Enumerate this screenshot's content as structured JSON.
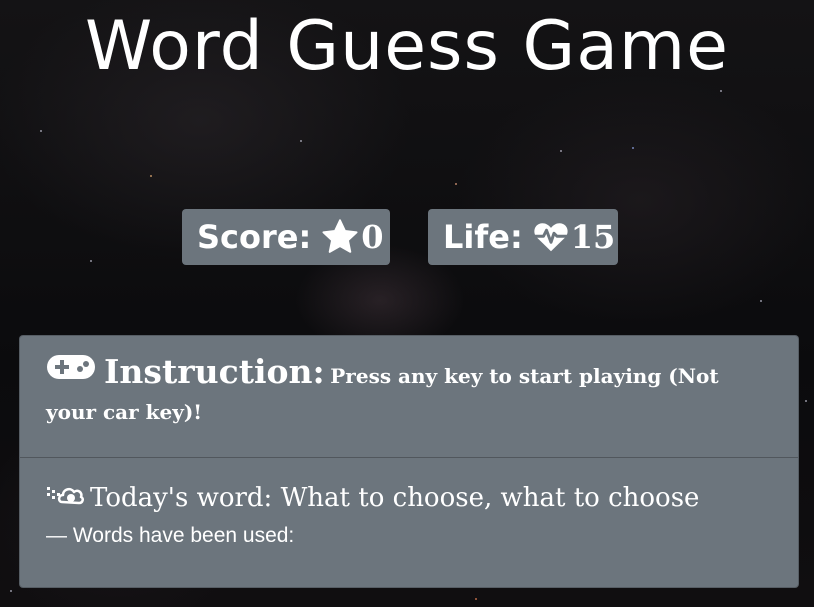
{
  "header": {
    "title": "Word Guess Game"
  },
  "score": {
    "label": "Score:",
    "value": "0",
    "icon": "star-icon"
  },
  "life": {
    "label": "Life:",
    "value": "15",
    "icon": "heartbeat-icon"
  },
  "instruction": {
    "icon": "gamepad-icon",
    "title": "Instruction:",
    "text": "Press any key to start playing (Not your car key)!"
  },
  "today": {
    "icon": "cloud-meatball-icon",
    "label": "Today's word:",
    "word": "What to choose, what to choose"
  },
  "used": {
    "text": "— Words have been used:"
  },
  "colors": {
    "badge_bg": "#6c757d",
    "text": "#ffffff"
  }
}
